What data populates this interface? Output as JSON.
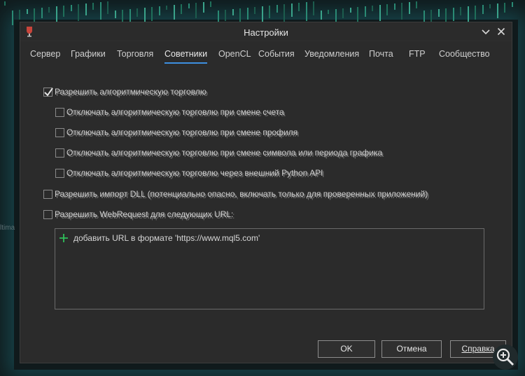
{
  "window": {
    "title": "Настройки"
  },
  "tabs": [
    {
      "label": "Сервер"
    },
    {
      "label": "Графики"
    },
    {
      "label": "Торговля"
    },
    {
      "label": "Советники"
    },
    {
      "label": "OpenCL"
    },
    {
      "label": "События"
    },
    {
      "label": "Уведомления"
    },
    {
      "label": "Почта"
    },
    {
      "label": "FTP"
    },
    {
      "label": "Сообщество"
    }
  ],
  "active_tab": "Советники",
  "options": [
    {
      "label": "Разрешить алгоритмическую торговлю",
      "checked": true
    },
    {
      "label": "Отключать алгоритмическую торговлю при смене счета",
      "checked": false
    },
    {
      "label": "Отключать алгоритмическую торговлю при смене профиля",
      "checked": false
    },
    {
      "label": "Отключать алгоритмическую торговлю при смене символа или периода графика",
      "checked": false
    },
    {
      "label": "Отключать алгоритмическую торговлю через внешний Python API",
      "checked": false
    },
    {
      "label": "Разрешить импорт DLL (потенциально опасно, включать только для проверенных приложений)",
      "checked": false
    },
    {
      "label": "Разрешить WebRequest для следующих URL:",
      "checked": false
    }
  ],
  "url_list": {
    "add_label": "добавить URL в формате 'https://www.mql5.com'"
  },
  "buttons": {
    "ok": "OK",
    "cancel": "Отмена",
    "help": "Справка"
  },
  "backdrop": {
    "label": "ltima"
  },
  "colors": {
    "dialog_bg": "#2b2b2b",
    "accent": "#3d8fe0",
    "plus": "#2fbf5a"
  }
}
